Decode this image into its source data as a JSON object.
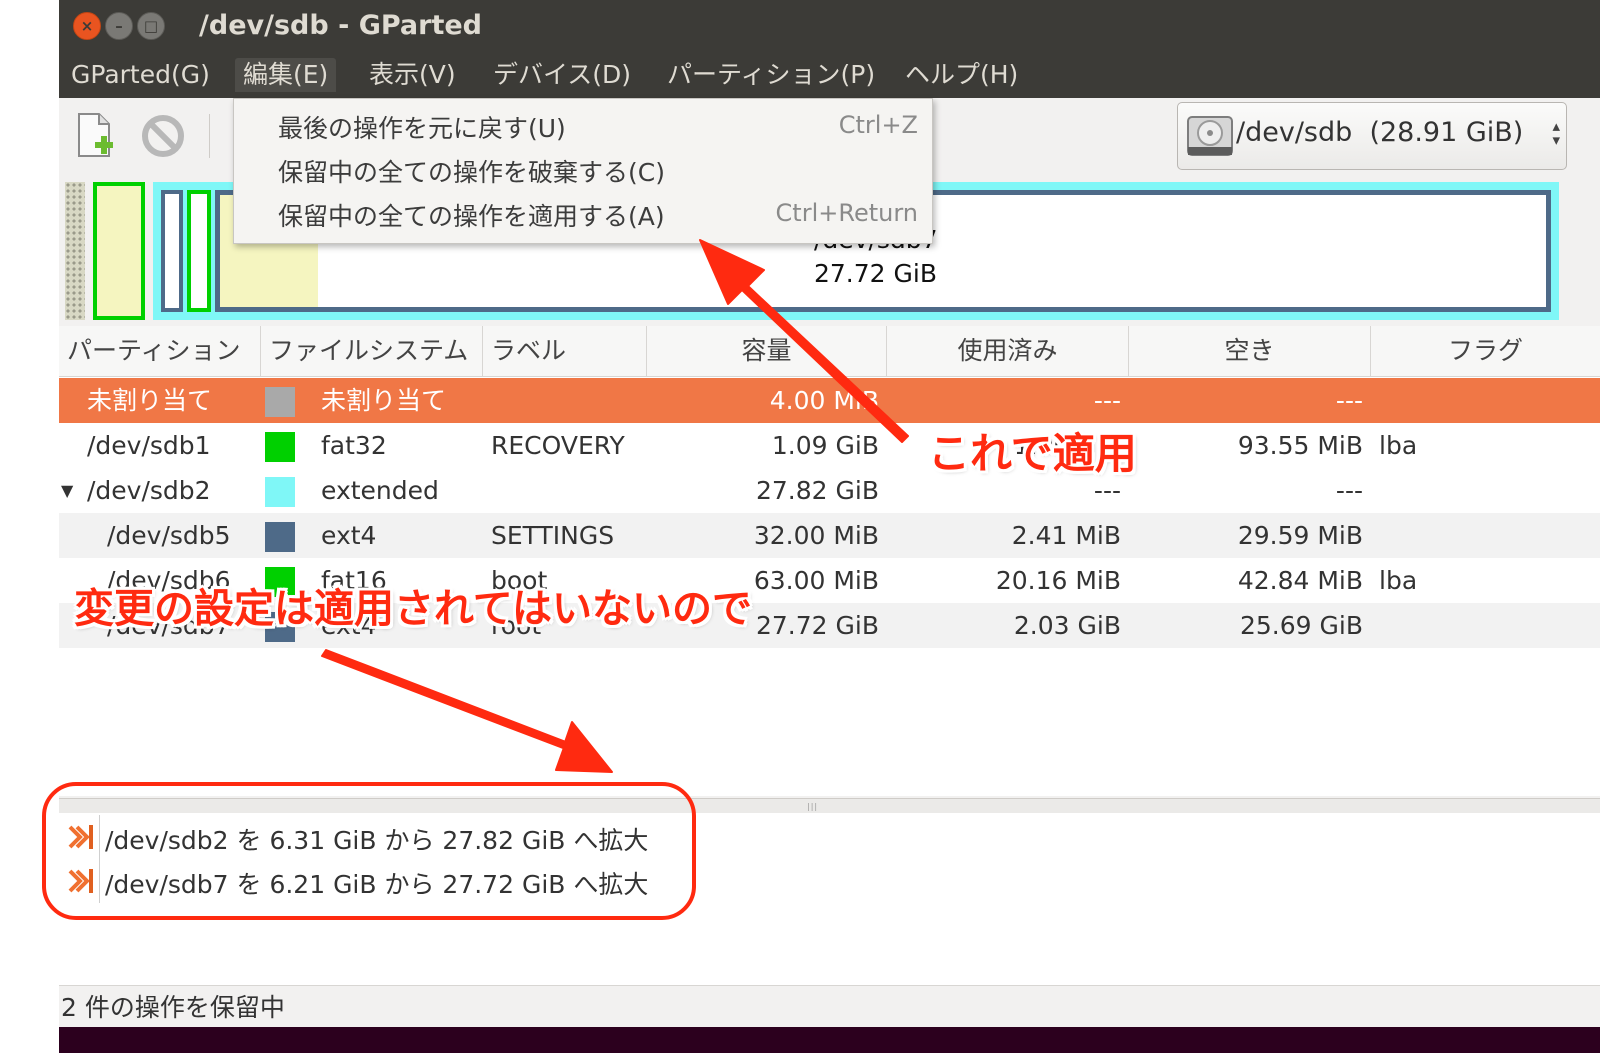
{
  "window": {
    "title": "/dev/sdb - GParted",
    "buttons": {
      "close": "×",
      "minimize": "–",
      "maximize": "□"
    }
  },
  "menubar": {
    "items": [
      {
        "label": "GParted(G)"
      },
      {
        "label": "編集(E)"
      },
      {
        "label": "表示(V)"
      },
      {
        "label": "デバイス(D)"
      },
      {
        "label": "パーティション(P)"
      },
      {
        "label": "ヘルプ(H)"
      }
    ]
  },
  "edit_menu": {
    "items": [
      {
        "label": "最後の操作を元に戻す(U)",
        "accel": "Ctrl+Z"
      },
      {
        "label": "保留中の全ての操作を破棄する(C)",
        "accel": ""
      },
      {
        "label": "保留中の全ての操作を適用する(A)",
        "accel": "Ctrl+Return"
      }
    ]
  },
  "toolbar": {
    "icons": [
      "new-partition-icon",
      "cancel-icon"
    ],
    "device_selector": {
      "device": "/dev/sdb",
      "size": "(28.91 GiB)"
    }
  },
  "disk_graph": {
    "label_line1": "/dev/sdb7",
    "label_line2": "27.72 GiB"
  },
  "partition_table": {
    "columns": [
      "パーティション",
      "ファイルシステム",
      "ラベル",
      "容量",
      "使用済み",
      "空き",
      "フラグ"
    ],
    "rows": [
      {
        "partition": "未割り当て",
        "fs_color": "#a9a9a9",
        "filesystem": "未割り当て",
        "label": "",
        "size": "4.00 MiB",
        "used": "---",
        "unused": "---",
        "flags": ""
      },
      {
        "partition": "/dev/sdb1",
        "fs_color": "#00d000",
        "filesystem": "fat32",
        "label": "RECOVERY",
        "size": "1.09 GiB",
        "used": "1.00 GiB",
        "unused": "93.55 MiB",
        "flags": "lba"
      },
      {
        "partition": "/dev/sdb2",
        "fs_color": "#7ff7f7",
        "filesystem": "extended",
        "label": "",
        "size": "27.82 GiB",
        "used": "---",
        "unused": "---",
        "flags": ""
      },
      {
        "partition": "/dev/sdb5",
        "fs_color": "#4e6a88",
        "filesystem": "ext4",
        "label": "SETTINGS",
        "size": "32.00 MiB",
        "used": "2.41 MiB",
        "unused": "29.59 MiB",
        "flags": ""
      },
      {
        "partition": "/dev/sdb6",
        "fs_color": "#00d000",
        "filesystem": "fat16",
        "label": "boot",
        "size": "63.00 MiB",
        "used": "20.16 MiB",
        "unused": "42.84 MiB",
        "flags": "lba"
      },
      {
        "partition": "/dev/sdb7",
        "fs_color": "#4e6a88",
        "filesystem": "ext4",
        "label": "root",
        "size": "27.72 GiB",
        "used": "2.03 GiB",
        "unused": "25.69 GiB",
        "flags": ""
      }
    ]
  },
  "pending_operations": [
    {
      "icon": "grow-partition-icon",
      "text": "/dev/sdb2 を 6.31 GiB から 27.82 GiB へ拡大"
    },
    {
      "icon": "grow-partition-icon",
      "text": "/dev/sdb7 を 6.21 GiB から 27.72 GiB へ拡大"
    }
  ],
  "statusbar": {
    "text": "2 件の操作を保留中"
  },
  "annotations": {
    "apply_note": "これで適用",
    "not_applied_note": "変更の設定は適用されてはいないので",
    "color": "#ff2a10"
  }
}
